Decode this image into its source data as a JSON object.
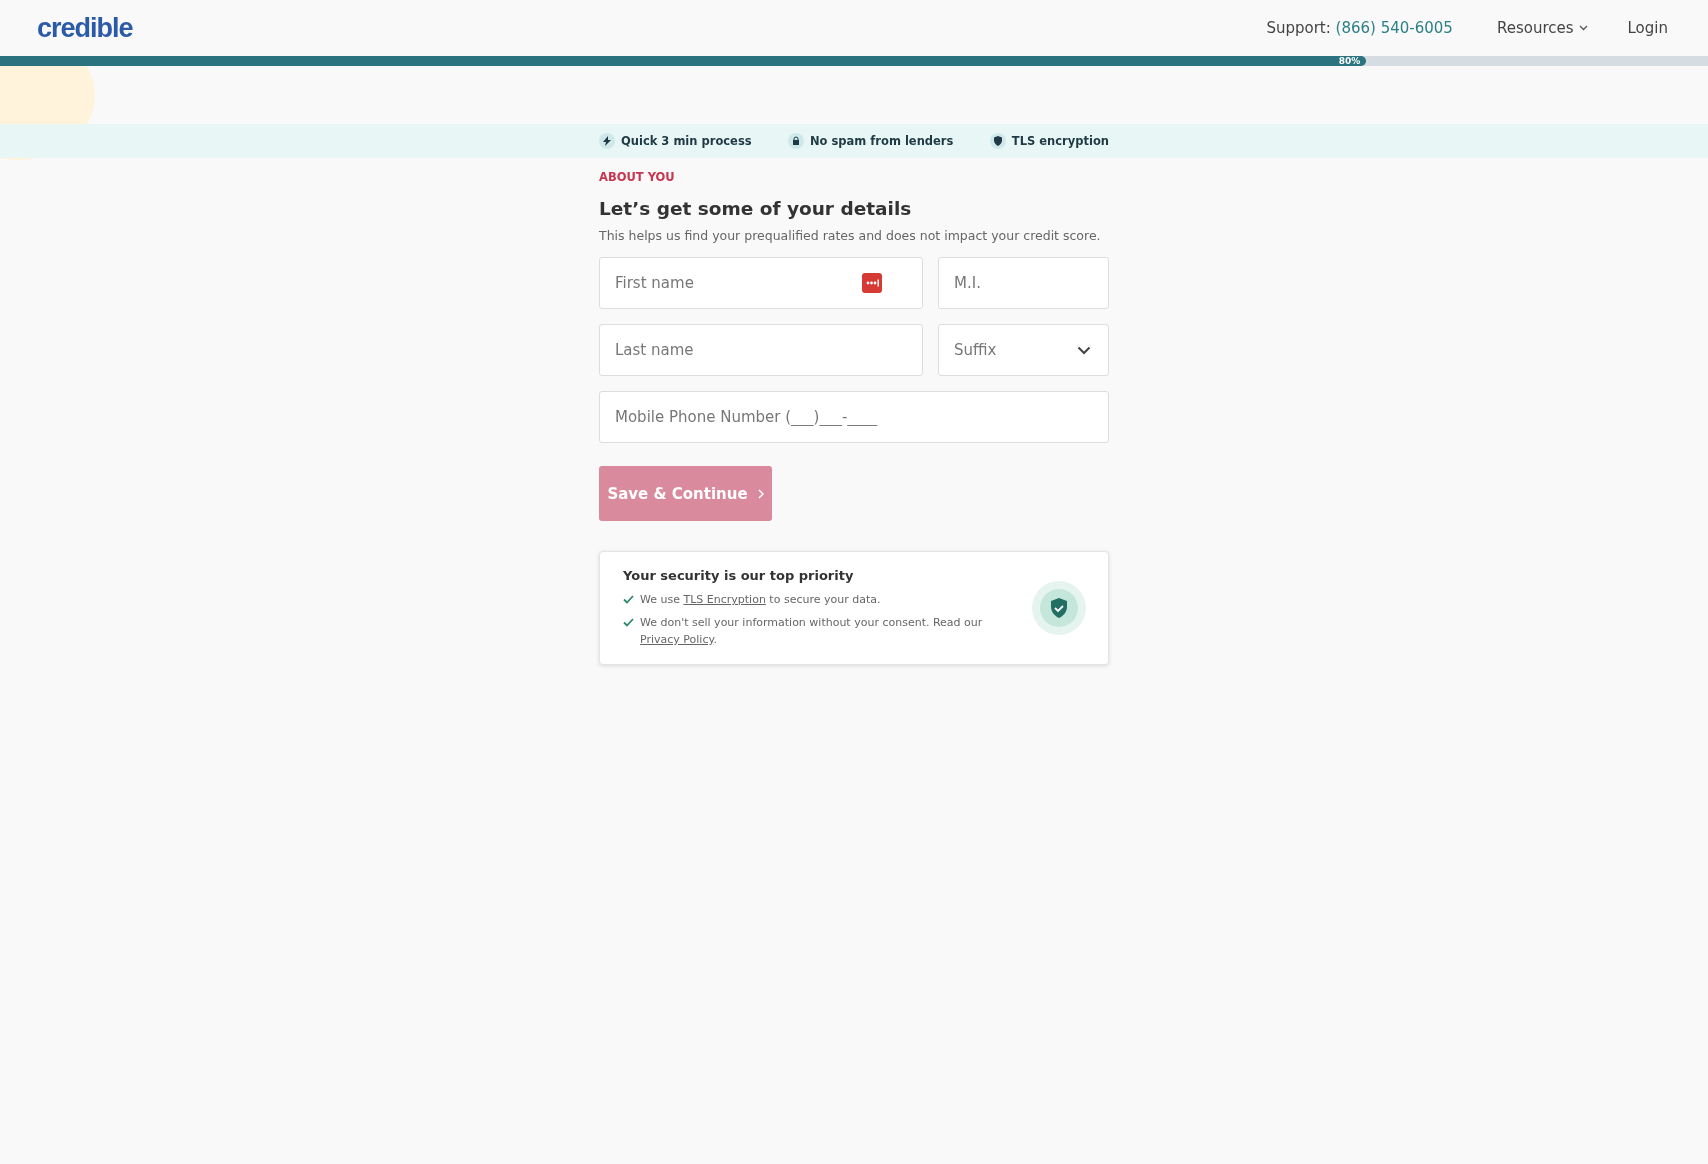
{
  "header": {
    "logo": "credible",
    "support_label": "Support:",
    "support_phone": "(866) 540-6005",
    "nav": [
      {
        "label": "Resources",
        "kind": "dropdown"
      },
      {
        "label": "Login",
        "kind": "link"
      }
    ]
  },
  "progress": {
    "level": 0.8,
    "reading": "80%"
  },
  "trust_banner": [
    {
      "label": "Quick 3 min process"
    },
    {
      "label": "No spam from lenders"
    },
    {
      "label": "TLS encryption"
    }
  ],
  "form": {
    "eyebrow": "ABOUT YOU",
    "title": "Let’s get some of your details",
    "subtitle": "This helps us find your prequalified rates and does not impact your credit score.",
    "rows": [
      [
        {
          "placeholder": "First name",
          "kind": "text",
          "autofill_icon": true
        },
        {
          "placeholder": "M.I.",
          "kind": "text"
        }
      ],
      [
        {
          "placeholder": "Last name",
          "kind": "text"
        },
        {
          "placeholder": "Suffix",
          "kind": "select"
        }
      ],
      [
        {
          "placeholder": "Mobile Phone Number (___)___-____",
          "kind": "text"
        }
      ]
    ],
    "submit": {
      "label": "Save & Continue",
      "disabled": true
    }
  },
  "security": {
    "title": "Your security is our top priority",
    "items": [
      {
        "before": "We use ",
        "link": "TLS Encryption",
        "after": " to secure your data."
      },
      {
        "before": "We don't sell your information without your consent. Read our ",
        "link": "Privacy Policy",
        "after": "."
      }
    ]
  }
}
